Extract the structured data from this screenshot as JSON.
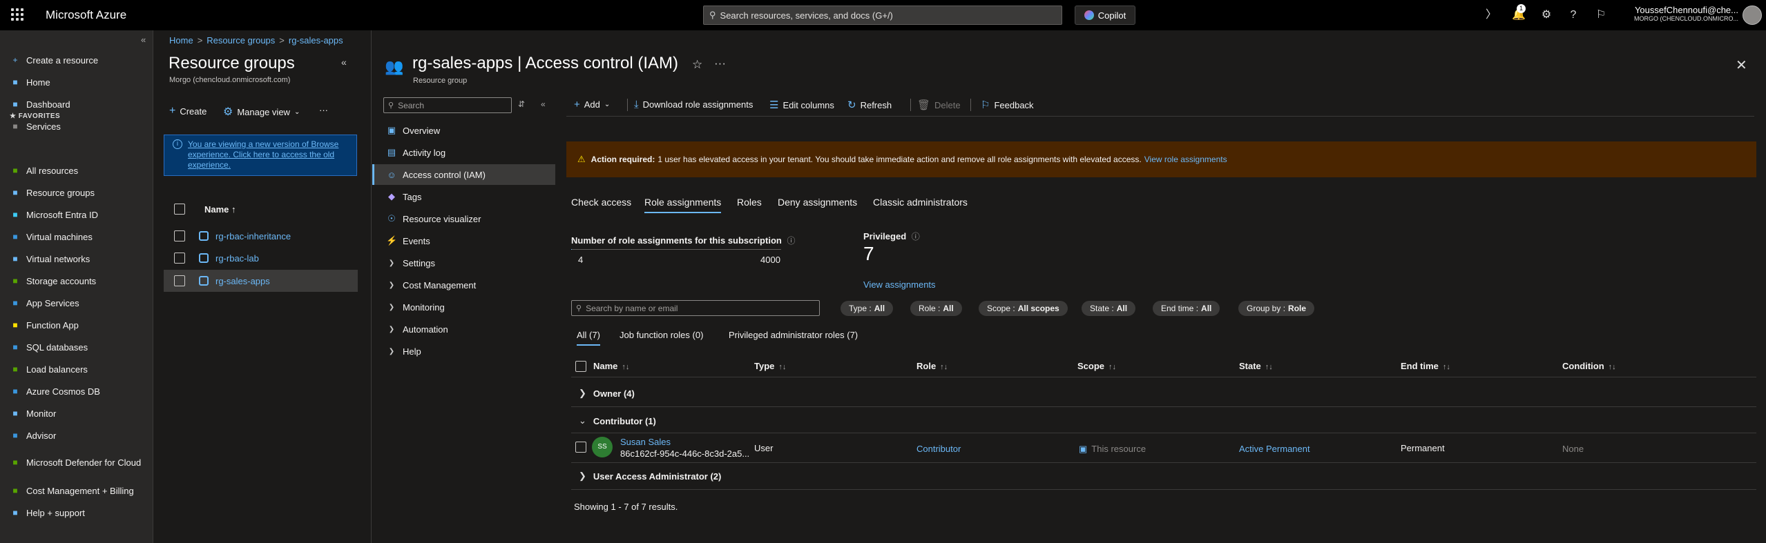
{
  "topbar": {
    "brand": "Microsoft Azure",
    "search_placeholder": "Search resources, services, and docs (G+/)",
    "copilot": "Copilot",
    "notifications_count": "1",
    "user_name": "YoussefChennoufi@che...",
    "user_tenant": "MORGO (CHENCLOUD.ONMICRO..."
  },
  "leftnav": {
    "items": [
      {
        "label": "Create a resource",
        "icon": "plus-icon",
        "color": "#6cb8f6"
      },
      {
        "label": "Home",
        "icon": "home-icon",
        "color": "#6cb8f6"
      },
      {
        "label": "Dashboard",
        "icon": "dashboard-icon",
        "color": "#6cb8f6"
      },
      {
        "label": "Services",
        "icon": "services-icon",
        "color": "#8a8886"
      }
    ],
    "favorites_label": "FAVORITES",
    "favorites": [
      {
        "label": "All resources",
        "icon": "all-resources-icon",
        "color": "#57a300"
      },
      {
        "label": "Resource groups",
        "icon": "resource-groups-icon",
        "color": "#6cb8f6"
      },
      {
        "label": "Microsoft Entra ID",
        "icon": "entra-icon",
        "color": "#3ccbf4"
      },
      {
        "label": "Virtual machines",
        "icon": "vm-icon",
        "color": "#3a96dd"
      },
      {
        "label": "Virtual networks",
        "icon": "vnet-icon",
        "color": "#6cb8f6"
      },
      {
        "label": "Storage accounts",
        "icon": "storage-icon",
        "color": "#57a300"
      },
      {
        "label": "App Services",
        "icon": "app-services-icon",
        "color": "#3a96dd"
      },
      {
        "label": "Function App",
        "icon": "function-icon",
        "color": "#fce100"
      },
      {
        "label": "SQL databases",
        "icon": "sql-icon",
        "color": "#3a96dd"
      },
      {
        "label": "Load balancers",
        "icon": "load-balancer-icon",
        "color": "#57a300"
      },
      {
        "label": "Azure Cosmos DB",
        "icon": "cosmos-icon",
        "color": "#3a96dd"
      },
      {
        "label": "Monitor",
        "icon": "monitor-icon",
        "color": "#6cb8f6"
      },
      {
        "label": "Advisor",
        "icon": "advisor-icon",
        "color": "#3a96dd"
      },
      {
        "label": "Microsoft Defender for Cloud",
        "icon": "defender-icon",
        "color": "#57a300"
      },
      {
        "label": "Cost Management + Billing",
        "icon": "cost-icon",
        "color": "#57a300"
      },
      {
        "label": "Help + support",
        "icon": "help-support-icon",
        "color": "#6cb8f6"
      }
    ]
  },
  "breadcrumb": [
    "Home",
    "Resource groups",
    "rg-sales-apps"
  ],
  "rgpanel": {
    "title": "Resource groups",
    "subtitle": "Morgo (chencloud.onmicrosoft.com)",
    "create": "Create",
    "manage_view": "Manage view",
    "info_text": "You are viewing a new version of Browse experience. Click here to access the old experience.",
    "name_header": "Name ↑",
    "rows": [
      "rg-rbac-inheritance",
      "rg-rbac-lab",
      "rg-sales-apps"
    ]
  },
  "header": {
    "title": "rg-sales-apps | Access control (IAM)",
    "subtitle": "Resource group"
  },
  "menu": {
    "search_placeholder": "Search",
    "items": [
      {
        "label": "Overview",
        "icon": "overview-icon"
      },
      {
        "label": "Activity log",
        "icon": "activity-log-icon"
      },
      {
        "label": "Access control (IAM)",
        "icon": "iam-icon"
      },
      {
        "label": "Tags",
        "icon": "tags-icon"
      },
      {
        "label": "Resource visualizer",
        "icon": "visualizer-icon"
      },
      {
        "label": "Events",
        "icon": "events-icon"
      },
      {
        "label": "Settings",
        "icon": "chevron-right-icon"
      },
      {
        "label": "Cost Management",
        "icon": "chevron-right-icon"
      },
      {
        "label": "Monitoring",
        "icon": "chevron-right-icon"
      },
      {
        "label": "Automation",
        "icon": "chevron-right-icon"
      },
      {
        "label": "Help",
        "icon": "chevron-right-icon"
      }
    ]
  },
  "toolbar": {
    "add": "Add",
    "download": "Download role assignments",
    "edit_columns": "Edit columns",
    "refresh": "Refresh",
    "delete": "Delete",
    "feedback": "Feedback"
  },
  "warning": {
    "bold": "Action required:",
    "text": "1 user has elevated access in your tenant. You should take immediate action and remove all role assignments with elevated access.",
    "link": "View role assignments"
  },
  "tabs": [
    "Check access",
    "Role assignments",
    "Roles",
    "Deny assignments",
    "Classic administrators"
  ],
  "stats": {
    "label": "Number of role assignments for this subscription",
    "current": "4",
    "max": "4000",
    "progress_fraction": 0.001,
    "privileged_label": "Privileged",
    "privileged_value": "7",
    "view_link": "View assignments"
  },
  "filters": {
    "search_placeholder": "Search by name or email",
    "pills": [
      {
        "label": "Type :",
        "value": "All"
      },
      {
        "label": "Role :",
        "value": "All"
      },
      {
        "label": "Scope :",
        "value": "All scopes"
      },
      {
        "label": "State :",
        "value": "All"
      },
      {
        "label": "End time :",
        "value": "All"
      },
      {
        "label": "Group by :",
        "value": "Role"
      }
    ]
  },
  "subtabs": [
    "All (7)",
    "Job function roles (0)",
    "Privileged administrator roles (7)"
  ],
  "table": {
    "columns": [
      "Name",
      "Type",
      "Role",
      "Scope",
      "State",
      "End time",
      "Condition"
    ],
    "groups": [
      "Owner (4)",
      "Contributor (1)",
      "User Access Administrator (2)"
    ],
    "row": {
      "initials": "SS",
      "name": "Susan Sales",
      "id": "86c162cf-954c-446c-8c3d-2a5...",
      "type": "User",
      "role": "Contributor",
      "scope": "This resource",
      "state": "Active Permanent",
      "end_time": "Permanent",
      "condition": "None"
    },
    "footer": "Showing 1 - 7 of 7 results."
  }
}
